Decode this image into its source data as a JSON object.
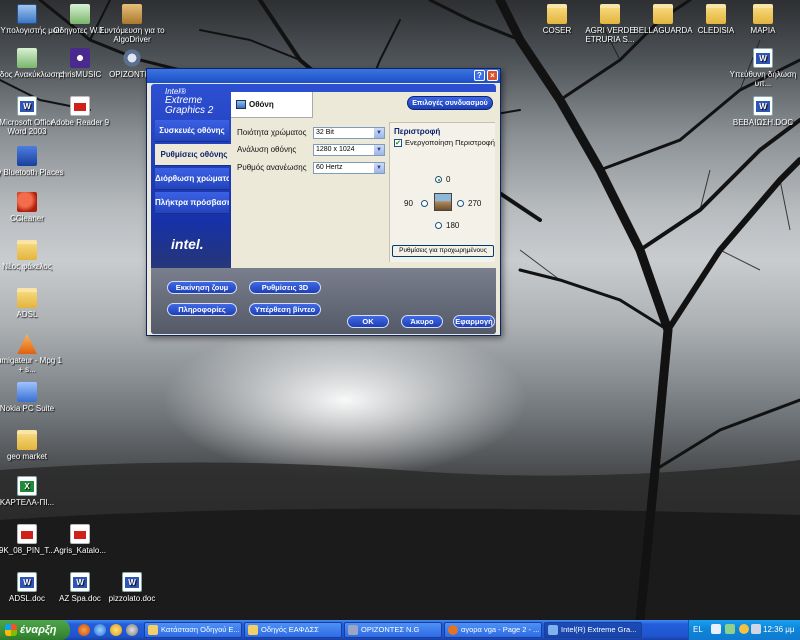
{
  "desktop": {
    "icons_left": [
      {
        "label": "Ο Υπολογιστής μου",
        "icon": "my-computer-icon"
      },
      {
        "label": "Οδηγοτες W.E.",
        "icon": "shortcut-icon"
      },
      {
        "label": "Συντόμευση για το AlgoDriver",
        "icon": "package-icon"
      },
      {
        "label": "Κάδος Ανακύκλωσης",
        "icon": "recycle-bin-icon"
      },
      {
        "label": "chrisMUSIC",
        "icon": "music-icon"
      },
      {
        "label": "ΟΡΙΖΟΝΤΕΣ",
        "icon": "gear-icon"
      },
      {
        "label": "Microsoft Office Word 2003",
        "icon": "word-icon"
      },
      {
        "label": "Adobe Reader 9",
        "icon": "pdf-icon"
      },
      {
        "label": "My Bluetooth Places",
        "icon": "bluetooth-icon"
      },
      {
        "label": "CCleaner",
        "icon": "ccleaner-icon"
      },
      {
        "label": "Νέος φάκελος",
        "icon": "folder-icon"
      },
      {
        "label": "ADSL",
        "icon": "folder-icon"
      },
      {
        "label": "Fumigateur - Mpg 1 + s...",
        "icon": "vlc-icon"
      },
      {
        "label": "Nokia PC Suite",
        "icon": "nokia-icon"
      },
      {
        "label": "geo market",
        "icon": "folder-icon"
      },
      {
        "label": "ΚΑΡΤΕΛΑ-ΠΙ...",
        "icon": "excel-icon"
      },
      {
        "label": "9K_08_PIN_T...",
        "icon": "pdf-icon"
      },
      {
        "label": "Agris_Katalo...",
        "icon": "pdf-icon"
      },
      {
        "label": "ADSL.doc",
        "icon": "word-icon"
      },
      {
        "label": "AZ Spa.doc",
        "icon": "word-icon"
      },
      {
        "label": "pizzolato.doc",
        "icon": "word-icon"
      }
    ],
    "icons_top": [
      {
        "label": "COSER",
        "icon": "folder-icon"
      },
      {
        "label": "AGRI VERDE ETRURIA S...",
        "icon": "folder-icon"
      },
      {
        "label": "BELLAGUARDA",
        "icon": "folder-icon"
      },
      {
        "label": "CLEDISIA",
        "icon": "folder-icon"
      },
      {
        "label": "ΜΑΡΙΑ",
        "icon": "folder-icon"
      }
    ],
    "icons_right": [
      {
        "label": "Υπεύθυνη δήλωση υπ...",
        "icon": "word-icon"
      },
      {
        "label": "ΒΕΒΑΙΩΣΗ.DOC",
        "icon": "word-icon"
      }
    ]
  },
  "dialog": {
    "brand_line1": "Intel®",
    "brand_line2": "Extreme",
    "brand_line3": "Graphics 2",
    "nav": [
      "Συσκευές οθόνης",
      "Ρυθμίσεις οθόνης",
      "Διόρθωση χρώματος",
      "Πλήκτρα πρόσβασης"
    ],
    "active_nav_index": 1,
    "logo": "intel.",
    "tab_label": "Οθόνη",
    "multi_display_button": "Επιλογές συνδυασμού",
    "settings": [
      {
        "label": "Ποιότητα χρώματος",
        "value": "32 Bit"
      },
      {
        "label": "Ανάλυση οθόνης",
        "value": "1280 x 1024"
      },
      {
        "label": "Ρυθμός ανανέωσης",
        "value": "60 Hertz"
      }
    ],
    "rotation": {
      "title": "Περιστροφή",
      "enable_label": "Ενεργοποίηση Περιστροφή",
      "enabled": true,
      "options": [
        "0",
        "90",
        "270",
        "180"
      ],
      "selected": "0",
      "advanced_button": "Ρυθμίσεις για προχωρημένους"
    },
    "buttons": {
      "zoom": "Εκκίνηση ζουμ",
      "settings_3d": "Ρυθμίσεις 3D",
      "info": "Πληροφορίες",
      "video": "Υπέρθεση βίντεο",
      "ok": "OK",
      "cancel": "Άκυρο",
      "apply": "Εφαρμογή"
    },
    "title_buttons": {
      "help": "?",
      "close": "×"
    }
  },
  "taskbar": {
    "start_label": "έναρξη",
    "tasks": [
      {
        "label": "Κατάσταση Οδηγού Ε...",
        "active": false
      },
      {
        "label": "Οδηγός ΕΑΦΔΣΣ",
        "active": false
      },
      {
        "label": "ΟΡΙΖΟΝΤΕΣ Ν.G",
        "active": false
      },
      {
        "label": "αγορα vga - Page 2 - ...",
        "active": false
      },
      {
        "label": "Intel(R) Extreme Gra...",
        "active": true
      }
    ],
    "tray_lang": "EL",
    "clock": "12:36 μμ"
  }
}
